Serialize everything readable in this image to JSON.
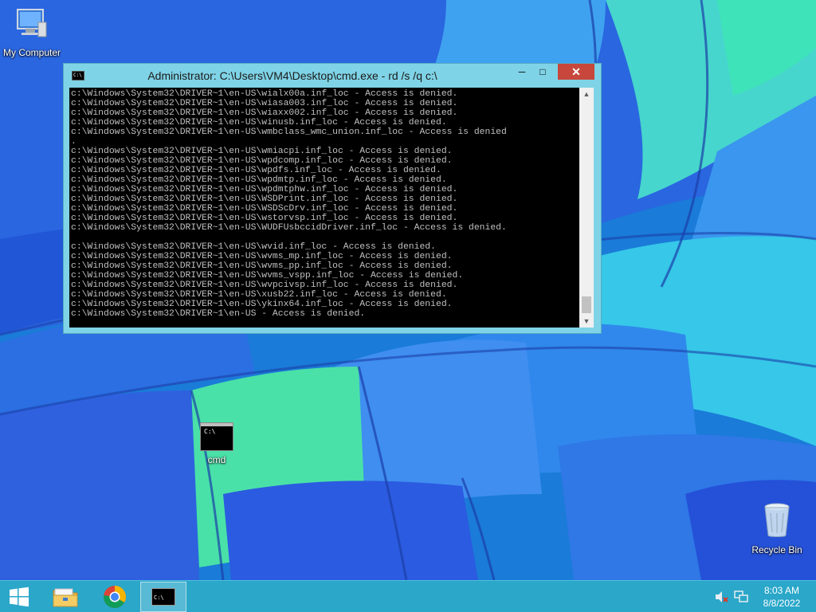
{
  "desktop": {
    "icons": [
      {
        "label": "My Computer"
      },
      {
        "label": "cmd"
      },
      {
        "label": "Recycle Bin"
      }
    ]
  },
  "cmd_window": {
    "title": "Administrator: C:\\Users\\VM4\\Desktop\\cmd.exe - rd  /s /q c:\\",
    "icon_text": "C:\\",
    "buttons": {
      "minimize": "─",
      "maximize": "□",
      "close": "✕"
    },
    "scroll_up": "▲",
    "scroll_down": "▼",
    "console_text": "c:\\Windows\\System32\\DRIVER~1\\en-US\\wialx00a.inf_loc - Access is denied.\nc:\\Windows\\System32\\DRIVER~1\\en-US\\wiasa003.inf_loc - Access is denied.\nc:\\Windows\\System32\\DRIVER~1\\en-US\\wiaxx002.inf_loc - Access is denied.\nc:\\Windows\\System32\\DRIVER~1\\en-US\\winusb.inf_loc - Access is denied.\nc:\\Windows\\System32\\DRIVER~1\\en-US\\wmbclass_wmc_union.inf_loc - Access is denied\n.\nc:\\Windows\\System32\\DRIVER~1\\en-US\\wmiacpi.inf_loc - Access is denied.\nc:\\Windows\\System32\\DRIVER~1\\en-US\\wpdcomp.inf_loc - Access is denied.\nc:\\Windows\\System32\\DRIVER~1\\en-US\\wpdfs.inf_loc - Access is denied.\nc:\\Windows\\System32\\DRIVER~1\\en-US\\wpdmtp.inf_loc - Access is denied.\nc:\\Windows\\System32\\DRIVER~1\\en-US\\wpdmtphw.inf_loc - Access is denied.\nc:\\Windows\\System32\\DRIVER~1\\en-US\\WSDPrint.inf_loc - Access is denied.\nc:\\Windows\\System32\\DRIVER~1\\en-US\\WSDScDrv.inf_loc - Access is denied.\nc:\\Windows\\System32\\DRIVER~1\\en-US\\wstorvsp.inf_loc - Access is denied.\nc:\\Windows\\System32\\DRIVER~1\\en-US\\WUDFUsbccidDriver.inf_loc - Access is denied.\n\nc:\\Windows\\System32\\DRIVER~1\\en-US\\wvid.inf_loc - Access is denied.\nc:\\Windows\\System32\\DRIVER~1\\en-US\\wvms_mp.inf_loc - Access is denied.\nc:\\Windows\\System32\\DRIVER~1\\en-US\\wvms_pp.inf_loc - Access is denied.\nc:\\Windows\\System32\\DRIVER~1\\en-US\\wvms_vspp.inf_loc - Access is denied.\nc:\\Windows\\System32\\DRIVER~1\\en-US\\wvpcivsp.inf_loc - Access is denied.\nc:\\Windows\\System32\\DRIVER~1\\en-US\\xusb22.inf_loc - Access is denied.\nc:\\Windows\\System32\\DRIVER~1\\en-US\\ykinx64.inf_loc - Access is denied.\nc:\\Windows\\System32\\DRIVER~1\\en-US - Access is denied."
  },
  "taskbar": {
    "cmd_icon_text": "C:\\",
    "clock": {
      "time": "8:03 AM",
      "date": "8/8/2022"
    },
    "tray_icons": [
      "volume-muted-icon",
      "network-icon"
    ]
  },
  "colors": {
    "taskbar": "#2aa7c9",
    "window_frame": "#7fd3e6",
    "close_button": "#c7473c",
    "console_bg": "#000000",
    "console_text": "#c0c0c0"
  }
}
